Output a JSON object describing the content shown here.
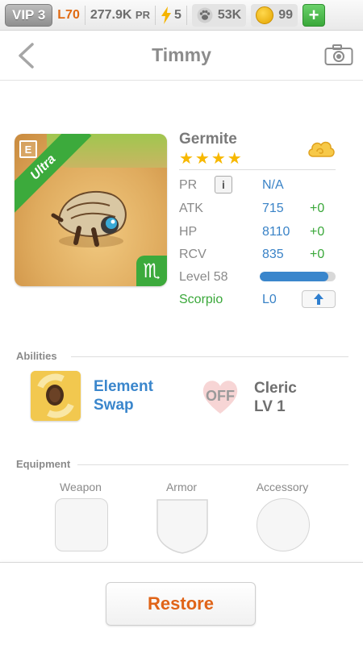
{
  "topbar": {
    "vip": "VIP 3",
    "level": "L70",
    "pr_value": "277.9K",
    "pr_unit": "PR",
    "energy": "5",
    "paw": "53K",
    "coins": "99",
    "plus": "+"
  },
  "header": {
    "title": "Timmy"
  },
  "card": {
    "rarity": "Ultra",
    "doc_letter": "E",
    "zodiac_symbol": "♏"
  },
  "monster": {
    "name": "Germite",
    "stars": "★★★★",
    "pr_label": "PR",
    "pr_value": "N/A",
    "info": "i",
    "atk_label": "ATK",
    "atk": "715",
    "atk_plus": "+0",
    "hp_label": "HP",
    "hp": "8110",
    "hp_plus": "+0",
    "rcv_label": "RCV",
    "rcv": "835",
    "rcv_plus": "+0",
    "level_label": "Level 58",
    "level_progress": 0.9,
    "zodiac_name": "Scorpio",
    "zodiac_level": "L0"
  },
  "abilities": {
    "label": "Abilities",
    "ability1": {
      "line1": "Element",
      "line2": "Swap"
    },
    "ability2": {
      "state": "OFF",
      "line1": "Cleric",
      "line2": "LV 1"
    }
  },
  "equipment": {
    "label": "Equipment",
    "weapon": "Weapon",
    "armor": "Armor",
    "accessory": "Accessory"
  },
  "restore": "Restore",
  "colors": {
    "accent_blue": "#3a86cc",
    "accent_green": "#3aa83a",
    "accent_orange": "#e06418",
    "star": "#f7b800"
  }
}
